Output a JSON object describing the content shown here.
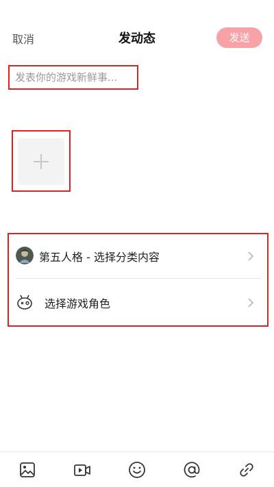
{
  "header": {
    "cancel_label": "取消",
    "title": "发动态",
    "send_label": "发送"
  },
  "post": {
    "placeholder": "发表你的游戏新鲜事...",
    "value": ""
  },
  "options": {
    "category_label": "第五人格 - 选择分类内容",
    "role_label": "选择游戏角色"
  },
  "toolbar": {
    "icons": [
      "image-icon",
      "video-icon",
      "emoji-icon",
      "mention-icon",
      "link-icon"
    ]
  },
  "colors": {
    "send_button": "#f6a2a6",
    "highlight_border": "#e02020",
    "icon_stroke": "#333333"
  }
}
